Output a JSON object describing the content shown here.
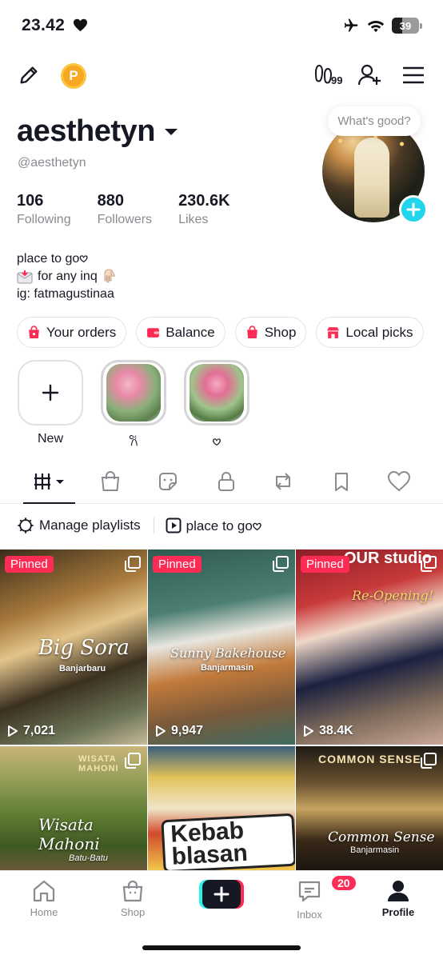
{
  "status": {
    "time": "23.42",
    "battery": "39"
  },
  "nav": {
    "points_label": "P",
    "visits_count": "99"
  },
  "profile": {
    "username": "aesthetyn",
    "handle": "@aesthetyn",
    "bubble": "What's good?",
    "stats": [
      {
        "value": "106",
        "label": "Following"
      },
      {
        "value": "880",
        "label": "Followers"
      },
      {
        "value": "230.6K",
        "label": "Likes"
      }
    ],
    "bio": [
      "place to go𖹭",
      "for any inq",
      "ig: fatmagustinaa"
    ]
  },
  "chips": [
    {
      "label": "Your orders",
      "color": "#fe2c55"
    },
    {
      "label": "Balance",
      "color": "#fe2c55"
    },
    {
      "label": "Shop",
      "color": "#fe2c55"
    },
    {
      "label": "Local picks",
      "color": "#fe2c55"
    }
  ],
  "highlights": {
    "new_label": "New",
    "items": [
      "𐙚",
      "𖹭"
    ]
  },
  "playlists": {
    "manage_label": "Manage playlists",
    "playlist_name": "place to go𖹭"
  },
  "grid": [
    {
      "pinned": "Pinned",
      "views": "7,021",
      "caption": "Big Sora",
      "sub": "Banjarbaru"
    },
    {
      "pinned": "Pinned",
      "views": "9,947",
      "caption": "Sunny Bakehouse",
      "sub": "Banjarmasin"
    },
    {
      "pinned": "Pinned",
      "views": "38.4K",
      "caption": "Re-Opening!",
      "sign": "OUR studio"
    },
    {
      "caption": "Wisata Mahoni",
      "sub": "Batu-Batu",
      "sign": "WISATA MAHONI"
    },
    {
      "title": "Kebab blasan"
    },
    {
      "caption": "Common Sense",
      "sub": "Banjarmasin",
      "sign": "COMMON SENSE"
    }
  ],
  "bottom_nav": {
    "home": "Home",
    "shop": "Shop",
    "inbox": "Inbox",
    "inbox_badge": "20",
    "profile": "Profile"
  },
  "colors": {
    "accent": "#fe2c55",
    "cyan": "#25f4ee",
    "points": "#f7a823"
  }
}
